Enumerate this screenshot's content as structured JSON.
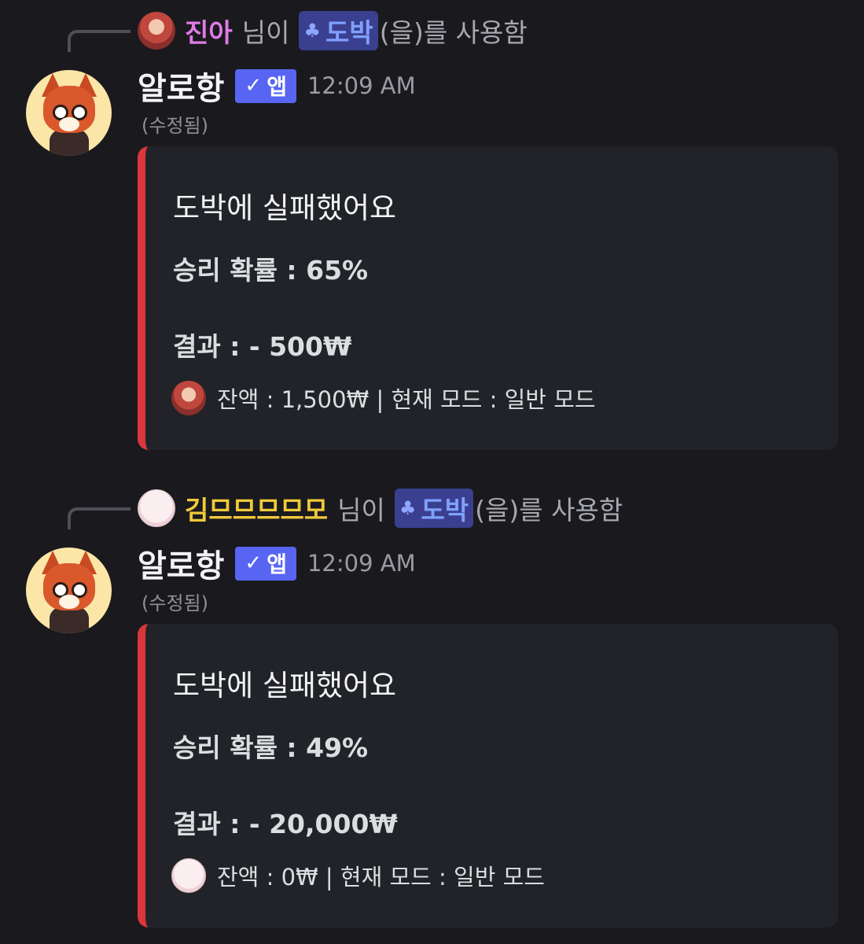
{
  "messages": [
    {
      "reply": {
        "username": "진아",
        "username_color": "#e07be6",
        "text_before": "님이",
        "command_icon": "♣",
        "command": "도박",
        "text_after": "(을)를 사용함"
      },
      "bot": {
        "name": "알로항",
        "badge": "앱",
        "timestamp": "12:09 AM",
        "edited": "(수정됨)"
      },
      "embed": {
        "accent_color": "#da373c",
        "title": "도박에 실패했어요",
        "probability": "승리 확률 : 65%",
        "result": "결과 : - 500₩",
        "footer": "잔액 : 1,500₩ | 현재 모드 : 일반 모드"
      }
    },
    {
      "reply": {
        "username": "김므므므므모",
        "username_color": "#f0c93a",
        "text_before": "님이",
        "command_icon": "♣",
        "command": "도박",
        "text_after": "(을)를 사용함"
      },
      "bot": {
        "name": "알로항",
        "badge": "앱",
        "timestamp": "12:09 AM",
        "edited": "(수정됨)"
      },
      "embed": {
        "accent_color": "#da373c",
        "title": "도박에 실패했어요",
        "probability": "승리 확률 : 49%",
        "result": "결과 : - 20,000₩",
        "footer": "잔액 : 0₩ | 현재 모드 : 일반 모드"
      }
    }
  ]
}
